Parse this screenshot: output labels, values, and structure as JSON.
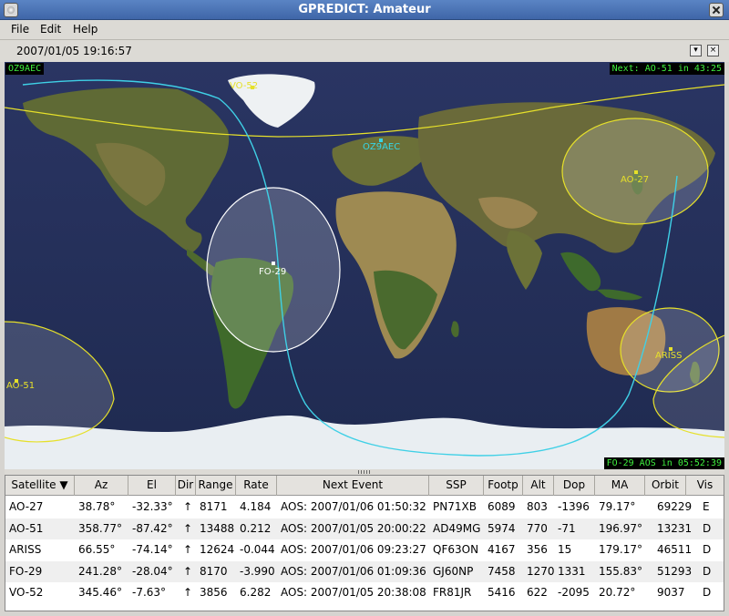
{
  "window": {
    "title": "GPREDICT: Amateur"
  },
  "menu": {
    "file": "File",
    "edit": "Edit",
    "help": "Help"
  },
  "datebar": {
    "datetime": "2007/01/05 19:16:57",
    "close_glyph": "×",
    "menu_glyph": "▾"
  },
  "map": {
    "qth_corner": "OZ9AEC",
    "next_event": "Next: AO-51  in 43:25",
    "bottom_status": "FO-29  AOS in 05:52:39",
    "qth_label": "OZ9AEC",
    "satellites": [
      {
        "name": "VO-52"
      },
      {
        "name": "AO-27"
      },
      {
        "name": "FO-29"
      },
      {
        "name": "AO-51"
      },
      {
        "name": "ARISS"
      }
    ]
  },
  "colors": {
    "footprint": "#e6e02a",
    "selected_footprint": "#ffffff",
    "ground_track": "#3fd0e6",
    "status_text": "#3ff03f",
    "qth": "#36d6e6"
  },
  "table": {
    "headers": [
      "Satellite ▼",
      "Az",
      "El",
      "Dir",
      "Range",
      "Rate",
      "Next Event",
      "SSP",
      "Footp",
      "Alt",
      "Dop",
      "MA",
      "Orbit",
      "Vis"
    ],
    "rows": [
      [
        "AO-27",
        "38.78°",
        "-32.33°",
        "↑",
        "8171",
        "4.184",
        "AOS: 2007/01/06 01:50:32",
        "PN71XB",
        "6089",
        "803",
        "-1396",
        "79.17°",
        "69229",
        "E"
      ],
      [
        "AO-51",
        "358.77°",
        "-87.42°",
        "↑",
        "13488",
        "0.212",
        "AOS: 2007/01/05 20:00:22",
        "AD49MG",
        "5974",
        "770",
        "-71",
        "196.97°",
        "13231",
        "D"
      ],
      [
        "ARISS",
        "66.55°",
        "-74.14°",
        "↑",
        "12624",
        "-0.044",
        "AOS: 2007/01/06 09:23:27",
        "QF63ON",
        "4167",
        "356",
        "15",
        "179.17°",
        "46511",
        "D"
      ],
      [
        "FO-29",
        "241.28°",
        "-28.04°",
        "↑",
        "8170",
        "-3.990",
        "AOS: 2007/01/06 01:09:36",
        "GJ60NP",
        "7458",
        "1270",
        "1331",
        "155.83°",
        "51293",
        "D"
      ],
      [
        "VO-52",
        "345.46°",
        "-7.63°",
        "↑",
        "3856",
        "6.282",
        "AOS: 2007/01/05 20:38:08",
        "FR81JR",
        "5416",
        "622",
        "-2095",
        "20.72°",
        "9037",
        "D"
      ]
    ]
  }
}
